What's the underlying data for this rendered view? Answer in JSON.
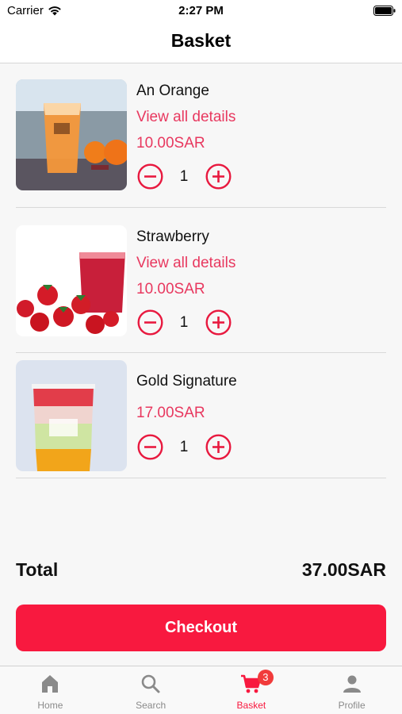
{
  "status_bar": {
    "carrier": "Carrier",
    "time": "2:27 PM",
    "wifi_icon": "wifi-icon",
    "battery_icon": "battery-icon"
  },
  "header": {
    "title": "Basket"
  },
  "items": [
    {
      "name": "An Orange",
      "details_link": "View all details",
      "price": "10.00SAR",
      "quantity": "1",
      "image": "orange-drink-photo"
    },
    {
      "name": "Strawberry",
      "details_link": "View all details",
      "price": "10.00SAR",
      "quantity": "1",
      "image": "strawberry-drink-photo"
    },
    {
      "name": "Gold Signature",
      "price": "17.00SAR",
      "quantity": "1",
      "image": "gold-signature-drink-photo"
    }
  ],
  "summary": {
    "total_label": "Total",
    "total_value": "37.00SAR"
  },
  "checkout": {
    "label": "Checkout"
  },
  "tab_bar": {
    "tabs": [
      {
        "label": "Home",
        "icon": "home-icon"
      },
      {
        "label": "Search",
        "icon": "search-icon"
      },
      {
        "label": "Basket",
        "icon": "cart-icon",
        "badge": "3",
        "active": true
      },
      {
        "label": "Profile",
        "icon": "profile-icon"
      }
    ]
  },
  "colors": {
    "accent": "#f8193f",
    "price": "#e8385f",
    "badge": "#f13b3b",
    "background": "#f7f7f7"
  }
}
